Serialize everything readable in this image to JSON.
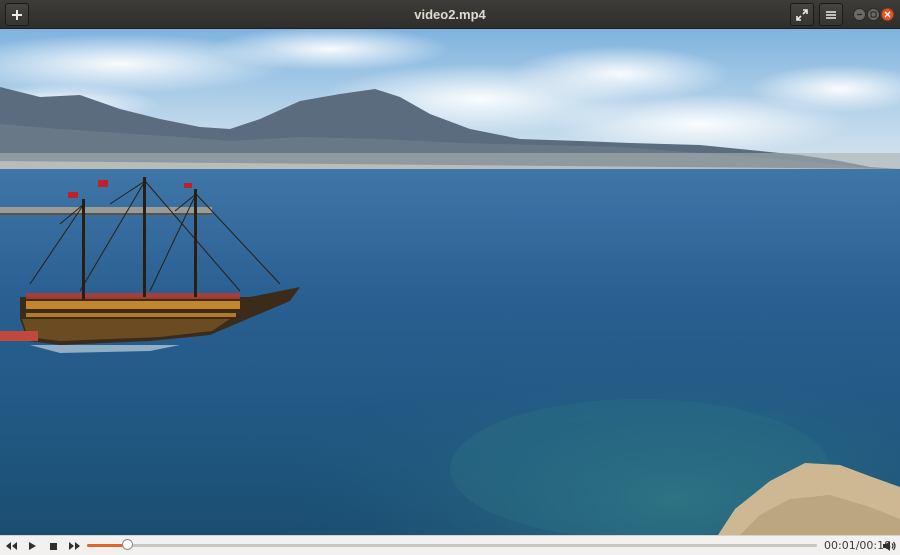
{
  "window": {
    "title": "video2.mp4",
    "new_button_icon": "plus-icon",
    "fullscreen_icon": "fullscreen-icon",
    "menu_icon": "hamburger-menu-icon",
    "window_controls": [
      "minimize",
      "maximize",
      "close"
    ]
  },
  "player": {
    "video_description_icon": "video-frame",
    "progress_fraction": 0.056,
    "time_display": "00:01/00:18",
    "accent_color": "#e0652b",
    "controls": [
      "rewind",
      "play",
      "stop",
      "fast-forward",
      "volume"
    ]
  }
}
